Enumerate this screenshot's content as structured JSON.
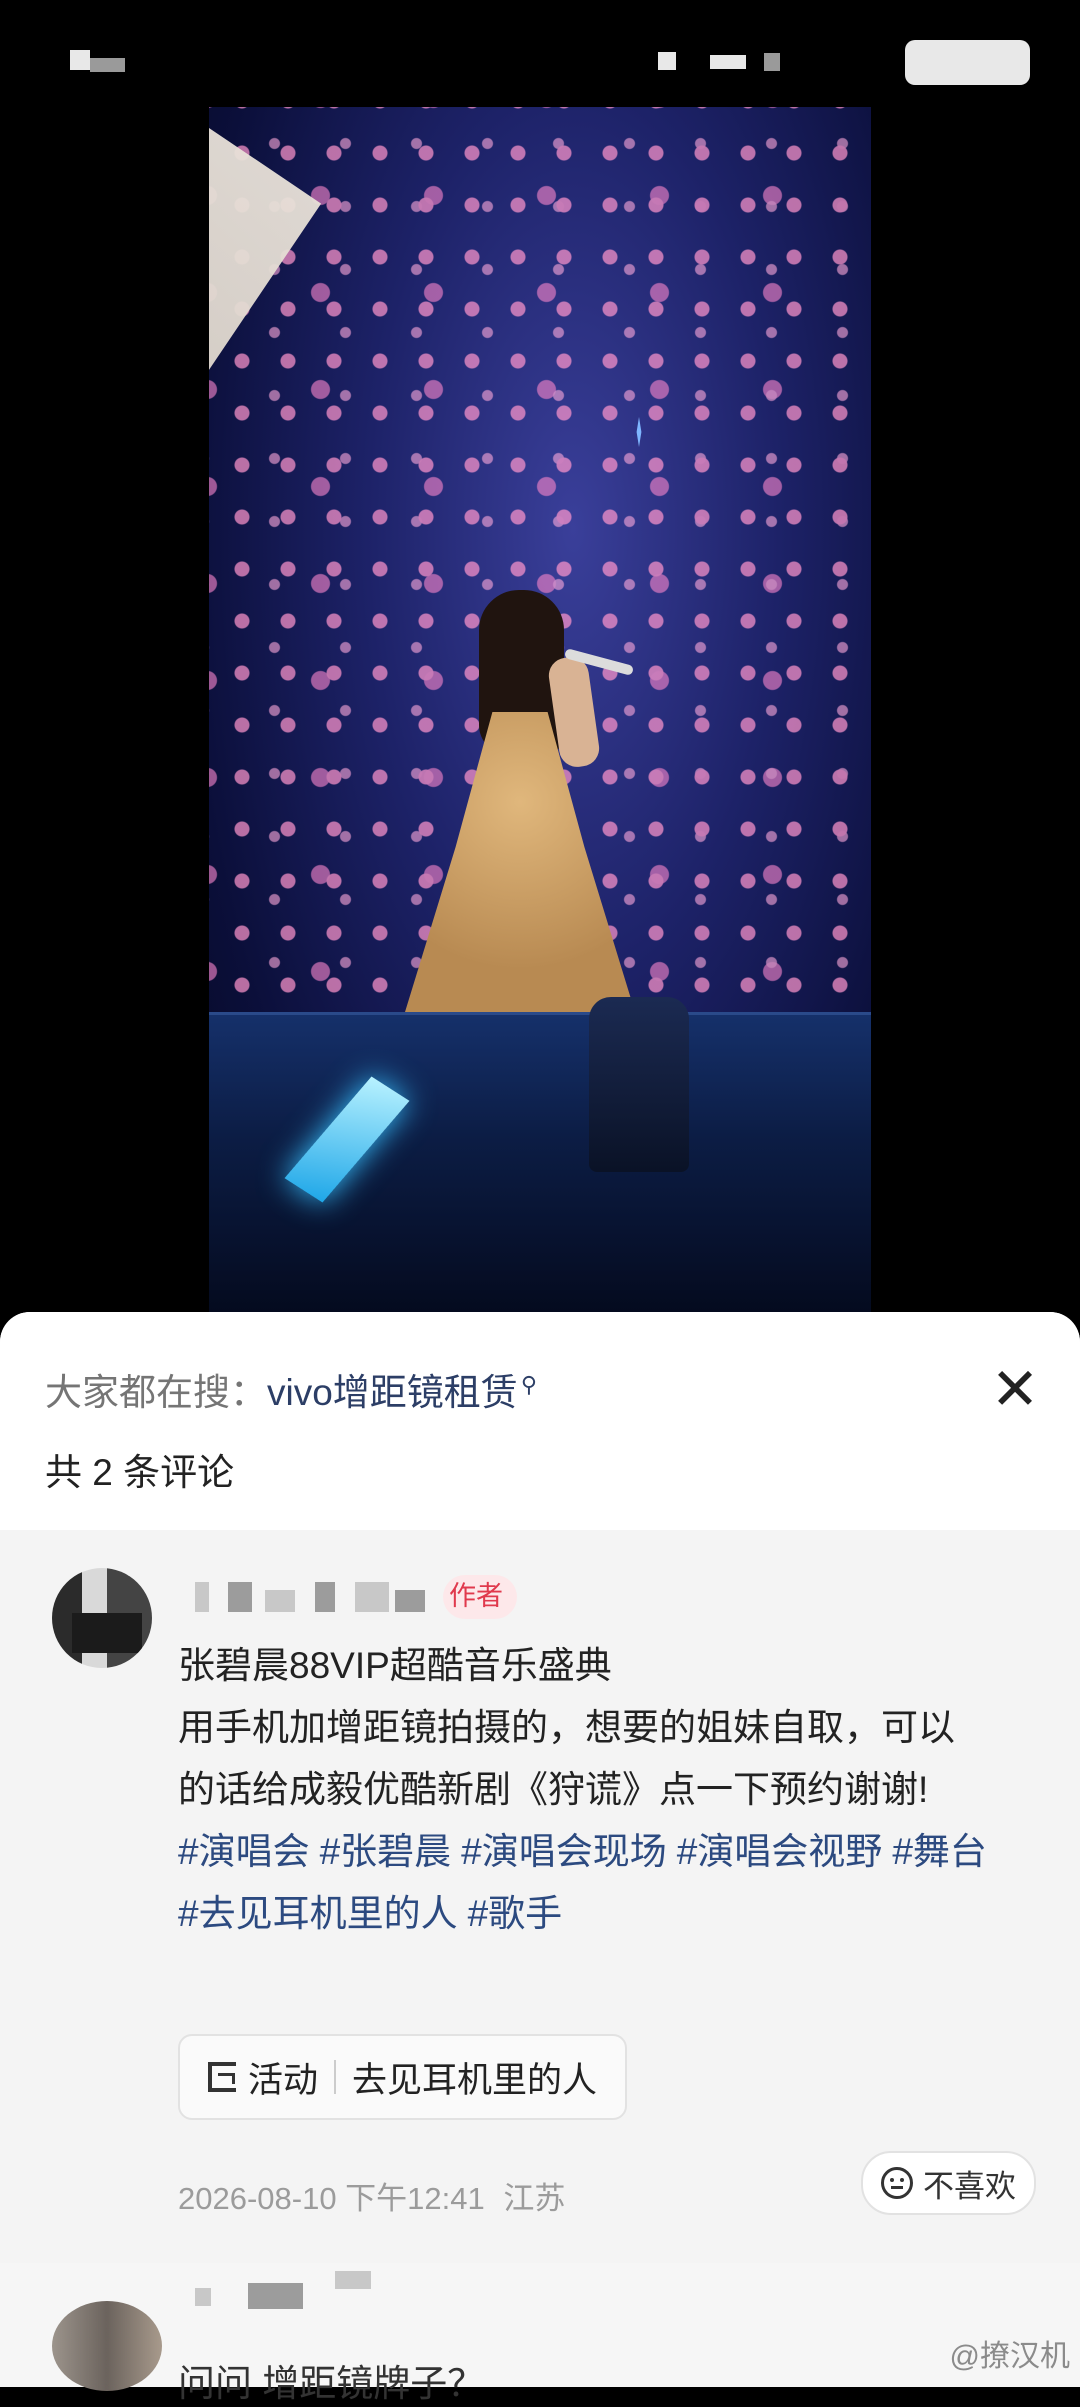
{
  "search_bar": {
    "prefix": "大家都在搜：",
    "term": "vivo增距镜租赁",
    "search_icon": "magnifier-icon"
  },
  "close_icon": "close-icon",
  "comment_count": "共 2 条评论",
  "comments": [
    {
      "author_badge": "作者",
      "line1": "张碧晨88VIP超酷音乐盛典",
      "line2": "用手机加增距镜拍摄的，想要的姐妹自取，可以",
      "line3": "的话给成毅优酷新剧《狩谎》点一下预约谢谢!",
      "hashtags_line1": [
        "#演唱会",
        "#张碧晨",
        "#演唱会现场",
        "#演唱会视野",
        "#舞台"
      ],
      "hashtags_line2": [
        "#去见耳机里的人",
        "#歌手"
      ],
      "activity_label": "活动",
      "activity_name": "去见耳机里的人",
      "timestamp": "2026-08-10 下午12:41",
      "location": "江苏",
      "dislike_label": "不喜欢"
    },
    {
      "preview_text": "问问 增距镜牌子？"
    }
  ],
  "watermark": "@撩汉机"
}
